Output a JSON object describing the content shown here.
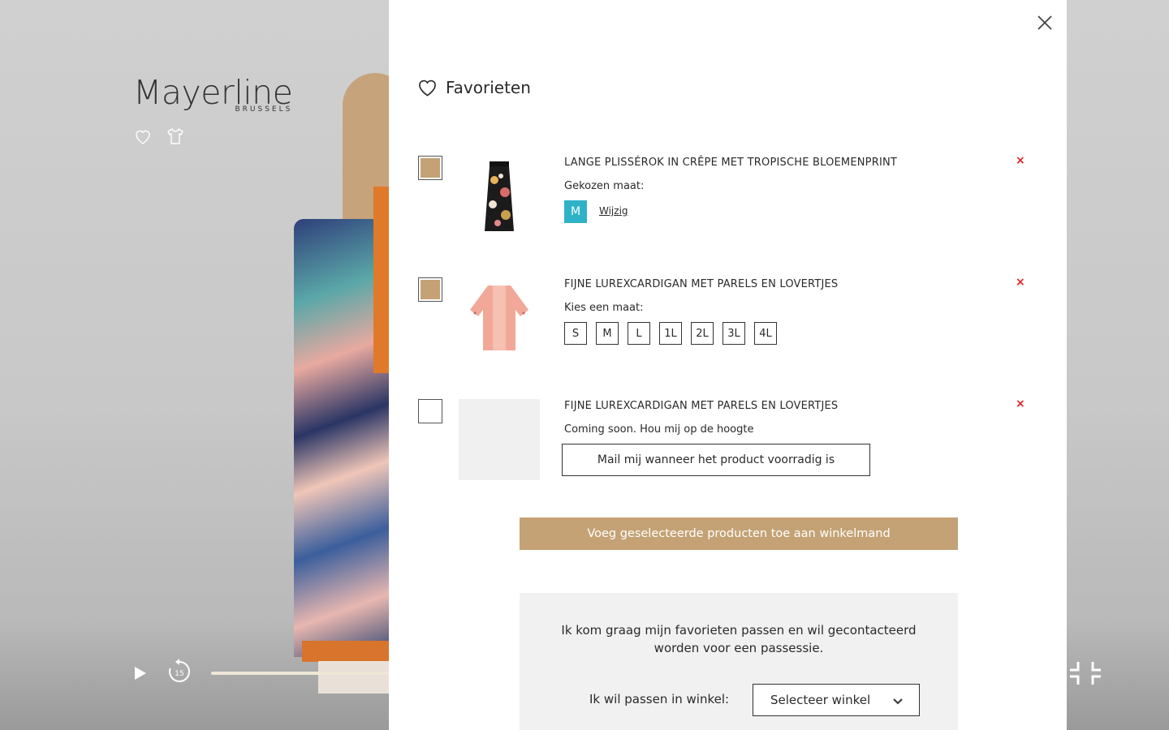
{
  "brand": {
    "name": "Mayerline",
    "sub": "BRUSSELS"
  },
  "modal": {
    "title": "Favorieten",
    "items": [
      {
        "title": "LANGE PLISSÉROK IN CRÊPE MET TROPISCHE BLOEMENPRINT",
        "sub": "Gekozen maat:",
        "size": "M",
        "change_label": "Wijzig",
        "selected": true
      },
      {
        "title": "FIJNE LUREXCARDIGAN MET PARELS EN LOVERTJES",
        "sub": "Kies een maat:",
        "sizes": [
          "S",
          "M",
          "L",
          "1L",
          "2L",
          "3L",
          "4L"
        ],
        "selected": true
      },
      {
        "title": "FIJNE LUREXCARDIGAN MET PARELS EN LOVERTJES",
        "sub": "Coming soon. Hou mij op de hoogte",
        "notify_label": "Mail mij wanneer het product voorradig is",
        "selected": false
      }
    ],
    "remove_label": "×",
    "add_to_cart_label": "Voeg geselecteerde producten toe aan winkelmand",
    "fitting": {
      "text": "Ik kom graag mijn favorieten passen en wil gecontacteerd worden voor een passessie.",
      "store_label": "Ik wil passen in winkel:",
      "store_select": "Selecteer winkel"
    }
  },
  "player": {
    "rewind_seconds": "15"
  },
  "colors": {
    "accent": "#c4a275",
    "size_chosen": "#2eb2c8",
    "remove": "#e0201e"
  }
}
